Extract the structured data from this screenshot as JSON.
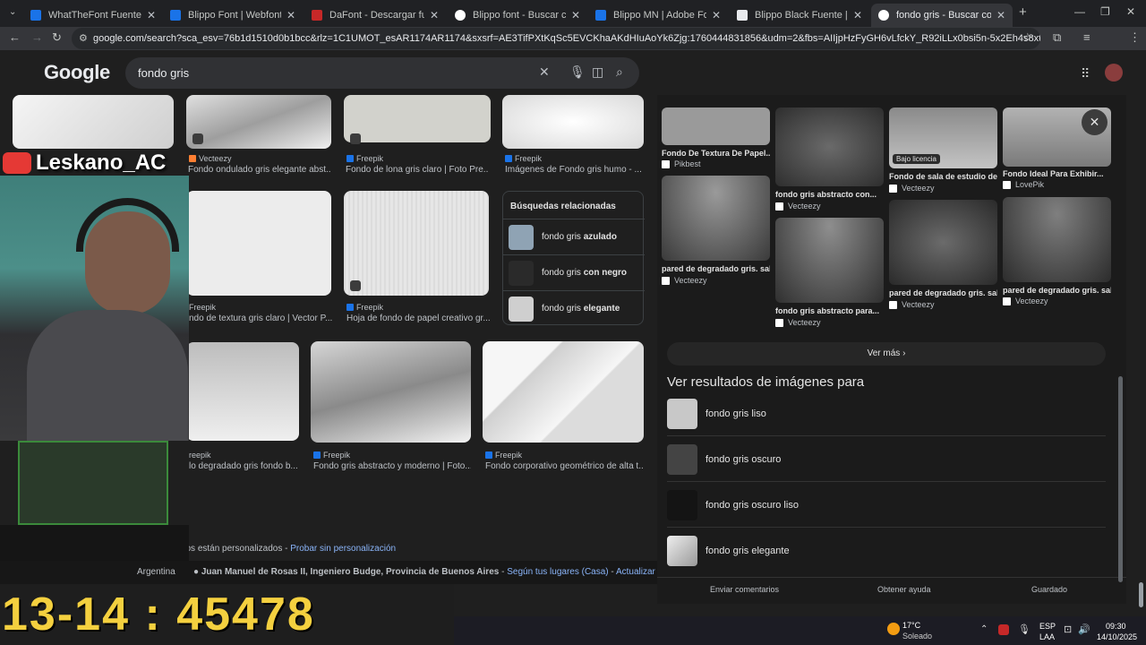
{
  "tabs": [
    {
      "label": "WhatTheFont Fuente Finder - l",
      "color": "#1a73e8"
    },
    {
      "label": "Blippo Font | Webfont & Deskt",
      "color": "#1a73e8"
    },
    {
      "label": "DaFont - Descargar fuentes",
      "color": "#c62828"
    },
    {
      "label": "Blippo font - Buscar con Goog",
      "color": "#ffffff"
    },
    {
      "label": "Blippo MN | Adobe Fonts",
      "color": "#1a73e8"
    },
    {
      "label": "Blippo Black Fuente | Descarga",
      "color": "#e8eaed"
    },
    {
      "label": "fondo gris - Buscar con Google",
      "color": "#ffffff"
    }
  ],
  "url": "google.com/search?sca_esv=76b1d1510d0b1bcc&rlz=1C1UMOT_esAR1174AR1174&sxsrf=AE3TifPXtKqSc5EVCKhaAKdHIuAoYk6Zjg:1760444831856&udm=2&fbs=AIIjpHzFyGH6vLfckY_R92iLLx0bsi5n-5x2Eh4s8xtfTc67D59WP27gBy X-Mtl1lqMCKaAT_I...",
  "google": {
    "logo": "Google",
    "query": "fondo gris"
  },
  "stream": {
    "name": "Leskano_AC",
    "counter": "13-14 : 45478"
  },
  "grid": [
    {
      "src": "Vecteezy",
      "caption": "Fondo ondulado gris elegante abst..."
    },
    {
      "src": "Freepik",
      "caption": "Fondo de lona gris claro | Foto Pre..."
    },
    {
      "src": "Freepik",
      "caption": "Imágenes de Fondo gris humo - ..."
    },
    {
      "src": "Freepik",
      "caption": "ndo de textura gris claro | Vector P..."
    },
    {
      "src": "Freepik",
      "caption": "Hoja de fondo de papel creativo gr..."
    },
    {
      "src": "reepik",
      "caption": "lo degradado gris fondo b..."
    },
    {
      "src": "Freepik",
      "caption": "Fondo gris abstracto y moderno | Foto..."
    },
    {
      "src": "Freepik",
      "caption": "Fondo corporativo geométrico de alta t..."
    }
  ],
  "related": {
    "title": "Búsquedas relacionadas",
    "items": [
      {
        "prefix": "fondo gris ",
        "bold": "azulado",
        "color": "#8fa3b4"
      },
      {
        "prefix": "fondo gris ",
        "bold": "con negro",
        "color": "#2a2a2a"
      },
      {
        "prefix": "fondo gris ",
        "bold": "elegante",
        "color": "#cfcfcf"
      }
    ]
  },
  "footer": {
    "personalized": "Los resultados están personalizados - ",
    "try_link": "Probar sin personalización",
    "country": "Argentina",
    "location": "Juan Manuel de Rosas II, Ingeniero Budge, Provincia de Buenos Aires",
    "by_places": "Según tus lugares (Casa)",
    "update": "Actualizar ubicac..."
  },
  "panel": {
    "tiles": [
      {
        "caption": "Fondo De Textura De Papel...",
        "src": "Pikbest"
      },
      {
        "caption": "fondo gris abstracto con...",
        "src": "Vecteezy"
      },
      {
        "caption": "Fondo de sala de estudio de...",
        "src": "Vecteezy",
        "badge": "Bajo licencia"
      },
      {
        "caption": "Fondo Ideal Para Exhibir...",
        "src": "LovePik"
      },
      {
        "caption": "pared de degradado gris. sal...",
        "src": "Vecteezy"
      },
      {
        "caption": "fondo gris abstracto para...",
        "src": "Vecteezy"
      },
      {
        "caption": "pared de degradado gris. sal...",
        "src": "Vecteezy"
      },
      {
        "caption": "pared de degradado gris. sal...",
        "src": "Vecteezy"
      }
    ],
    "more": "Ver más",
    "results_title": "Ver resultados de imágenes para",
    "results": [
      "fondo gris liso",
      "fondo gris oscuro",
      "fondo gris oscuro liso",
      "fondo gris elegante"
    ],
    "footer": [
      "Enviar comentarios",
      "Obtener ayuda",
      "Guardado"
    ]
  },
  "taskbar": {
    "temp": "17°C",
    "weather": "Soleado",
    "lang1": "ESP",
    "lang2": "LAA",
    "time": "09:30",
    "date": "14/10/2025"
  }
}
